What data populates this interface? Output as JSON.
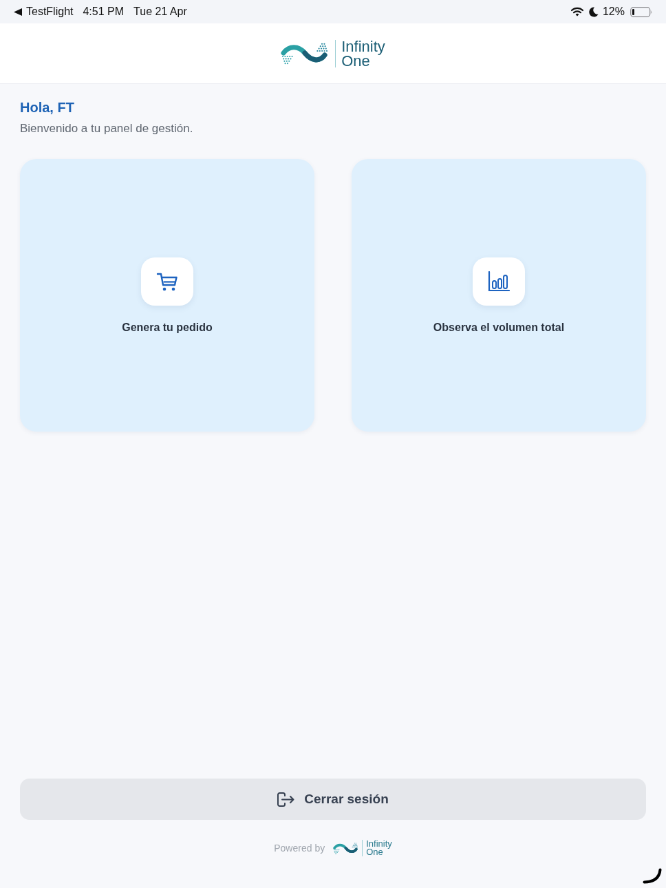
{
  "status_bar": {
    "back_app": "TestFlight",
    "time": "4:51 PM",
    "date": "Tue 21 Apr",
    "battery": "12%"
  },
  "header": {
    "logo": {
      "line_1": "Infinity",
      "line_2": "One"
    }
  },
  "greeting": {
    "title": "Hola, FT",
    "subtitle": "Bienvenido a tu panel de gestión."
  },
  "cards": [
    {
      "kind": "cart",
      "label": "Genera tu pedido"
    },
    {
      "kind": "chart",
      "label": "Observa el volumen total"
    }
  ],
  "logout_button": {
    "label": "Cerrar sesión"
  },
  "footer": {
    "powered_by": "Powered by",
    "logo": {
      "line_1": "Infinity",
      "line_2": "One"
    }
  }
}
